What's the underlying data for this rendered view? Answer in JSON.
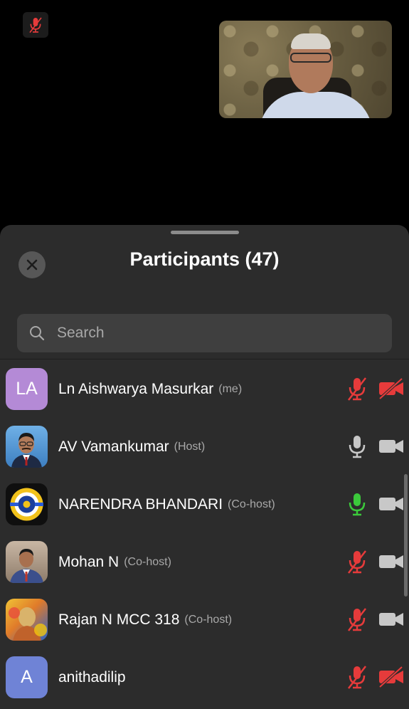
{
  "sheet": {
    "title": "Participants (47)",
    "search": {
      "placeholder": "Search"
    }
  },
  "participants": [
    {
      "initials": "LA",
      "name": "Ln Aishwarya Masurkar",
      "role": "(me)",
      "mic": "muted",
      "video": "off"
    },
    {
      "initials": "",
      "name": "AV Vamankumar",
      "role": "(Host)",
      "mic": "on",
      "video": "on"
    },
    {
      "initials": "",
      "name": "NARENDRA BHANDARI",
      "role": "(Co-host)",
      "mic": "speaking",
      "video": "on"
    },
    {
      "initials": "",
      "name": "Mohan N",
      "role": "(Co-host)",
      "mic": "muted",
      "video": "on"
    },
    {
      "initials": "",
      "name": "Rajan N MCC 318",
      "role": "(Co-host)",
      "mic": "muted",
      "video": "on"
    },
    {
      "initials": "A",
      "name": "anithadilip",
      "role": "",
      "mic": "muted",
      "video": "off"
    }
  ],
  "colors": {
    "muted": "#e63b3b",
    "speaking": "#3bc93b",
    "neutral": "#c8c8c8",
    "sheet_bg": "#2c2c2c"
  }
}
